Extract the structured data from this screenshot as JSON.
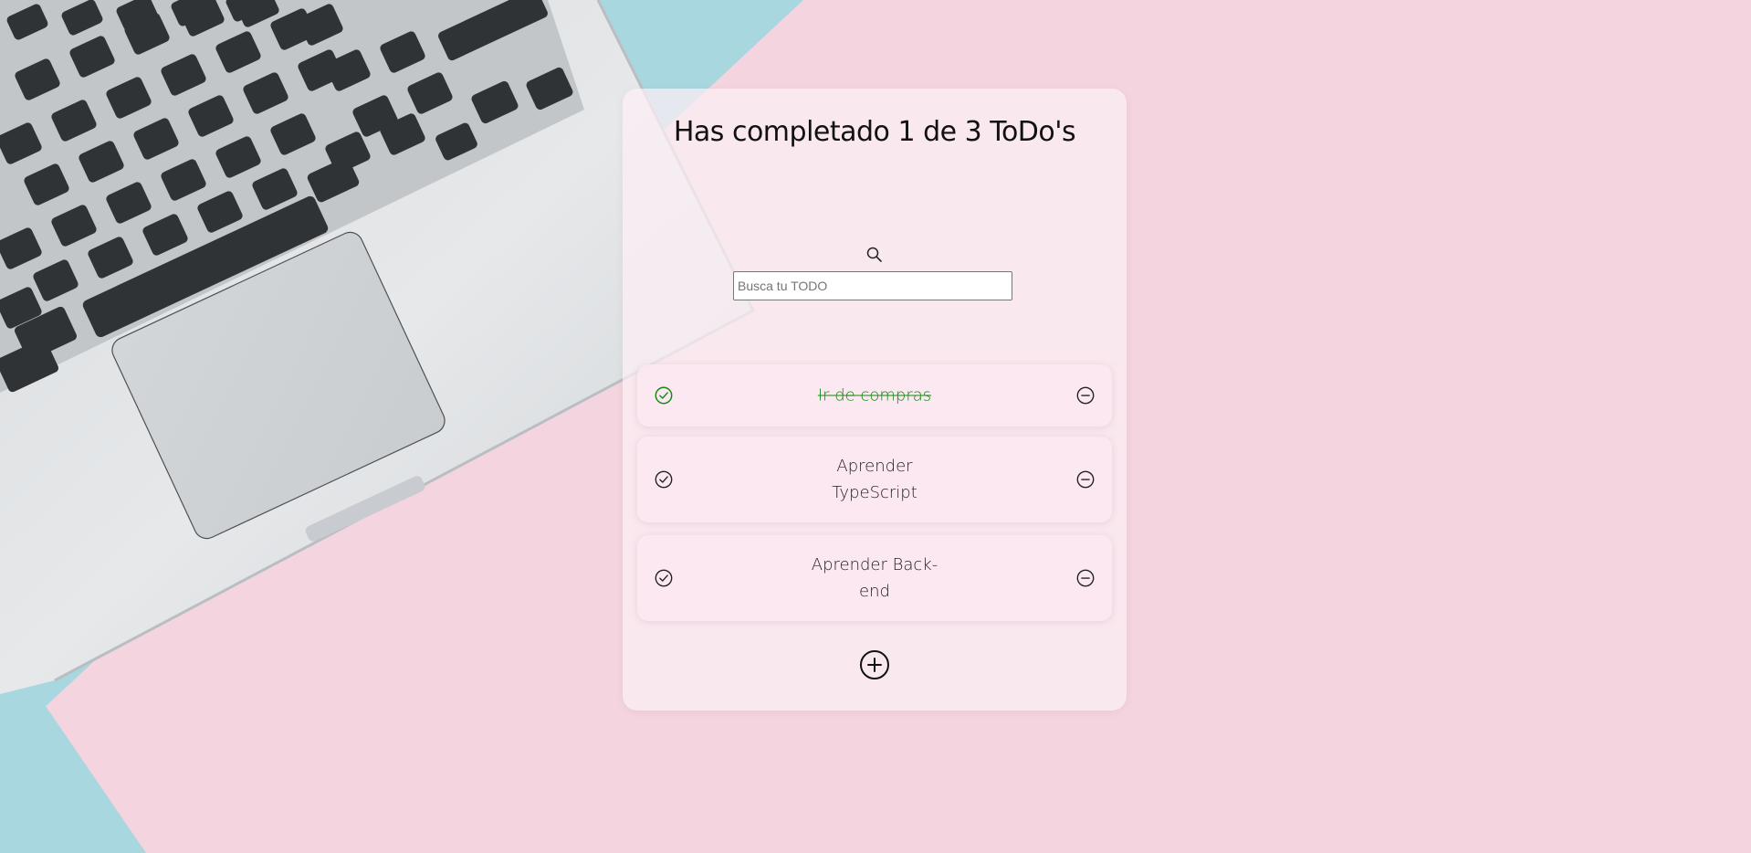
{
  "header": {
    "title": "Has completado 1 de 3 ToDo's"
  },
  "search": {
    "placeholder": "Busca tu TODO",
    "value": "",
    "icon": "search-icon"
  },
  "todos": [
    {
      "text": "Ir de compras",
      "completed": true
    },
    {
      "text": "Aprender TypeScript",
      "completed": false
    },
    {
      "text": "Aprender Back-end",
      "completed": false
    }
  ],
  "icons": {
    "check": "check-circle-icon",
    "delete": "minus-circle-icon",
    "add": "plus-circle-icon"
  },
  "colors": {
    "completed_text": "#148a14",
    "background_pink": "#f3d3df",
    "background_blue": "#a9d8e0"
  }
}
